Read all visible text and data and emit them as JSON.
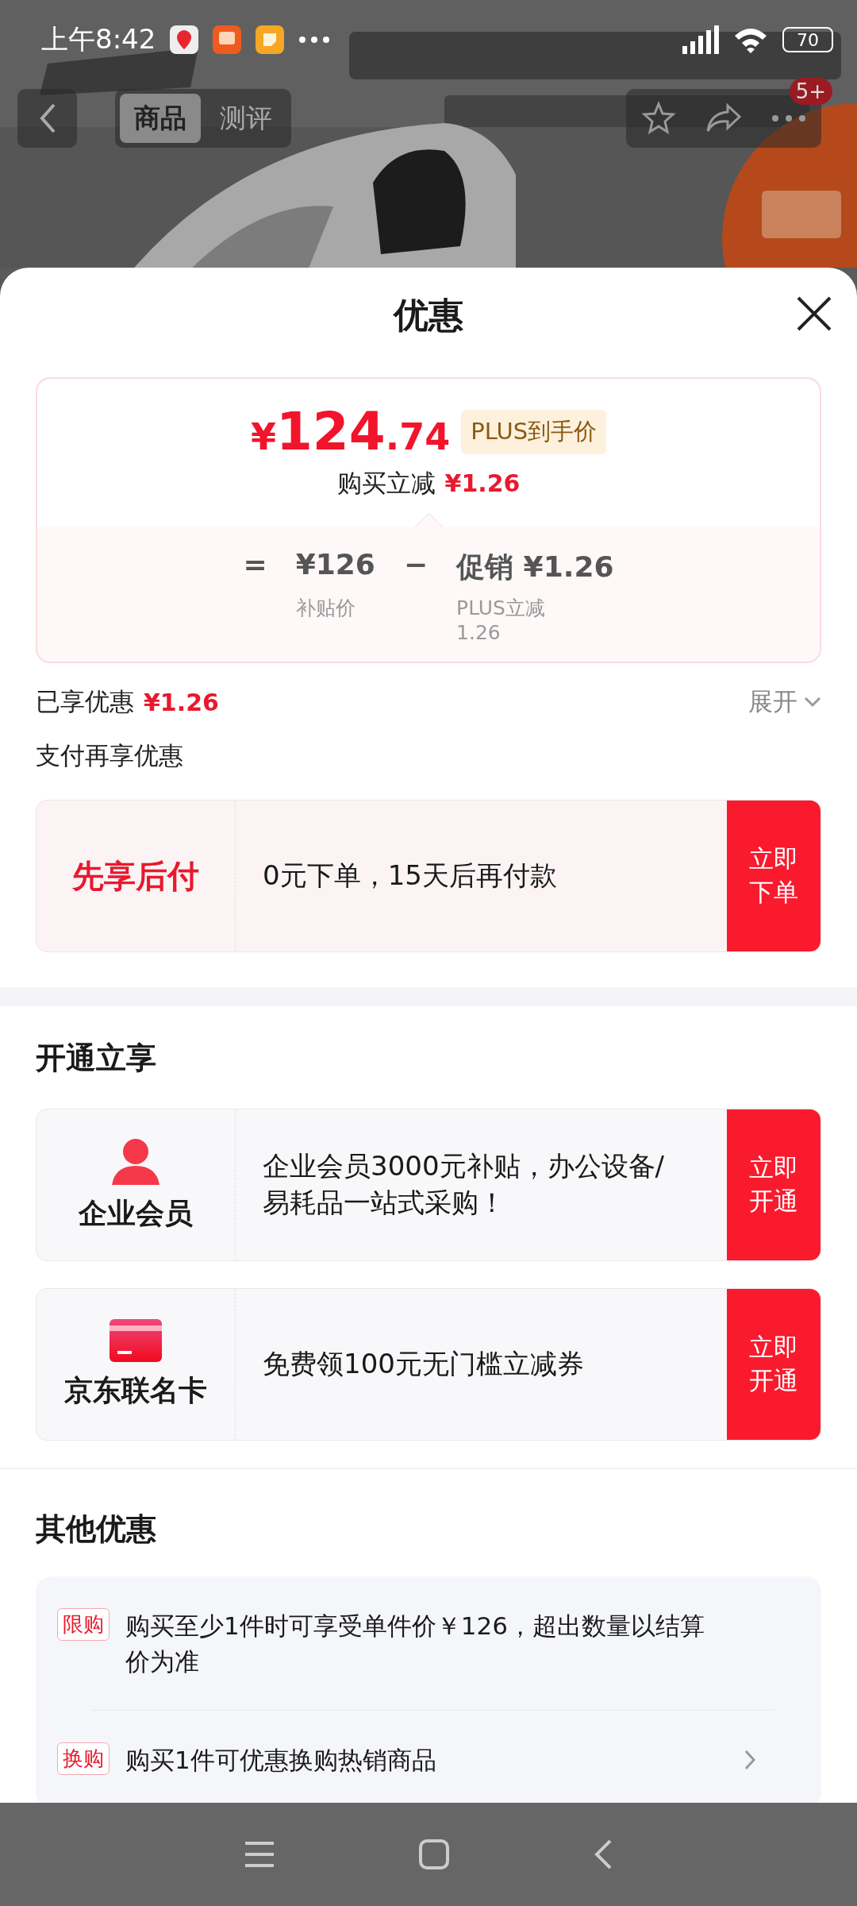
{
  "status_bar": {
    "time": "上午8:42",
    "battery": "70"
  },
  "top_nav": {
    "tabs": [
      {
        "label": "商品",
        "selected": true
      },
      {
        "label": "测评",
        "selected": false
      }
    ],
    "badge": "5+"
  },
  "sheet": {
    "title": "优惠"
  },
  "price_card": {
    "currency": "¥",
    "price_integer": "124",
    "price_decimal": ".74",
    "tag": "PLUS到手价",
    "reduce_label": "购买立减",
    "reduce_amount": "¥1.26",
    "breakdown": {
      "equals": "=",
      "base_amount": "¥126",
      "base_caption": "补贴价",
      "minus": "−",
      "discount_label": "促销",
      "discount_amount": "¥1.26",
      "discount_caption": "PLUS立减 1.26"
    }
  },
  "enjoyed": {
    "label": "已享优惠",
    "amount": "¥1.26",
    "expand": "展开"
  },
  "pay_section": {
    "title": "支付再享优惠",
    "offer": {
      "name": "先享后付",
      "text": "0元下单，15天后再付款",
      "button": "立即下单"
    }
  },
  "open_section": {
    "title": "开通立享",
    "offers": [
      {
        "kind": "person",
        "name": "企业会员",
        "text": "企业会员3000元补贴，办公设备/易耗品一站式采购！",
        "button": "立即开通"
      },
      {
        "kind": "card",
        "name": "京东联名卡",
        "text": "免费领100元无门槛立减券",
        "button": "立即开通"
      }
    ]
  },
  "other_section": {
    "title": "其他优惠",
    "items": [
      {
        "tag": "限购",
        "text": "购买至少1件时可享受单件价￥126，超出数量以结算价为准",
        "has_arrow": false
      },
      {
        "tag": "换购",
        "text": "购买1件可优惠换购热销商品",
        "has_arrow": true
      }
    ]
  }
}
